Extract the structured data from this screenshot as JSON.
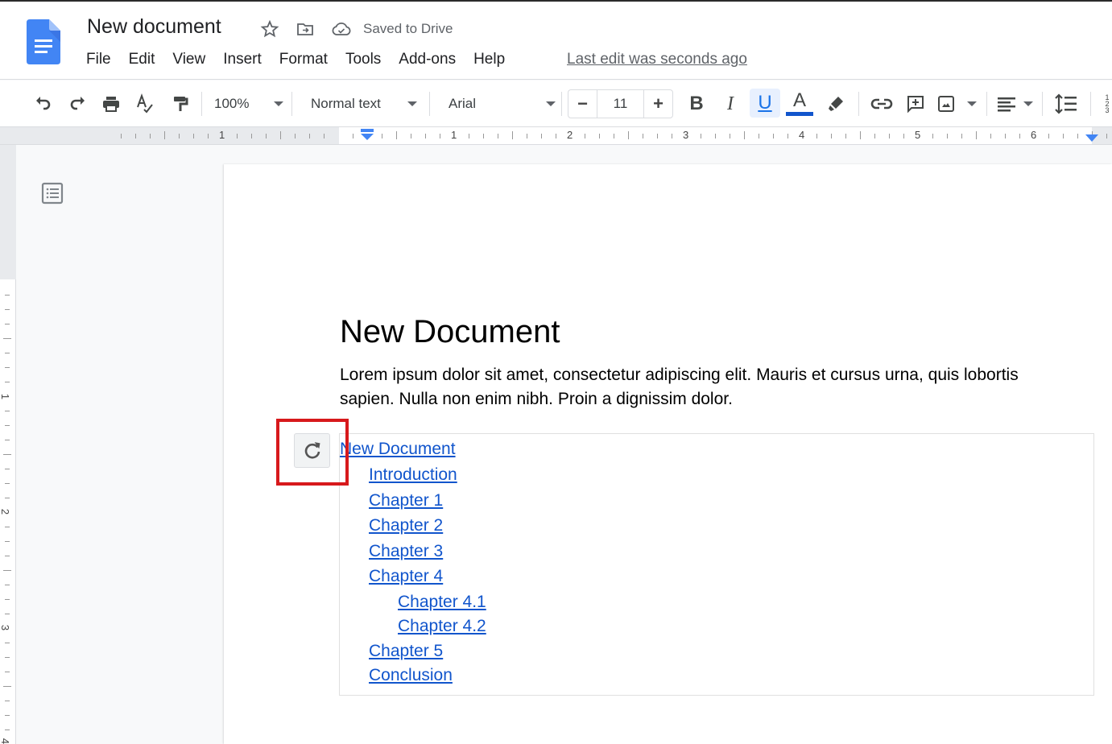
{
  "header": {
    "doc_title": "New document",
    "saved_status": "Saved to Drive",
    "last_edit": "Last edit was seconds ago",
    "icons": {
      "logo": "google-docs-logo",
      "star": "star-icon",
      "move": "move-to-folder-icon",
      "cloud": "cloud-done-icon"
    }
  },
  "menu": [
    "File",
    "Edit",
    "View",
    "Insert",
    "Format",
    "Tools",
    "Add-ons",
    "Help"
  ],
  "toolbar": {
    "zoom": "100%",
    "style": "Normal text",
    "font": "Arial",
    "font_size": "11",
    "minus": "−",
    "plus": "+",
    "bold": "B",
    "italic": "I",
    "underline": "U",
    "text_color_letter": "A",
    "text_color": "#1155cc",
    "underline_active": true
  },
  "ruler": {
    "numbers": [
      "1",
      "1",
      "2",
      "3",
      "4",
      "5",
      "6"
    ]
  },
  "vruler": {
    "numbers": [
      "1",
      "2",
      "3",
      "4"
    ]
  },
  "document": {
    "heading": "New Document",
    "paragraph": "Lorem ipsum dolor sit amet, consectetur adipiscing elit. Mauris et cursus urna, quis lobortis sapien. Nulla non enim nibh. Proin a dignissim dolor.",
    "toc": [
      {
        "label": "New Document",
        "level": 0
      },
      {
        "label": "Introduction",
        "level": 1
      },
      {
        "label": "Chapter 1",
        "level": 1
      },
      {
        "label": "Chapter 2",
        "level": 1
      },
      {
        "label": "Chapter 3",
        "level": 1
      },
      {
        "label": "Chapter 4",
        "level": 1
      },
      {
        "label": "Chapter 4.1",
        "level": 2
      },
      {
        "label": "Chapter 4.2",
        "level": 2
      },
      {
        "label": "Chapter 5",
        "level": 1
      },
      {
        "label": "Conclusion",
        "level": 1
      }
    ],
    "toc_link_color": "#1155cc",
    "refresh_button": "refresh-icon"
  },
  "annotation": {
    "highlight_color": "#d7191c"
  }
}
